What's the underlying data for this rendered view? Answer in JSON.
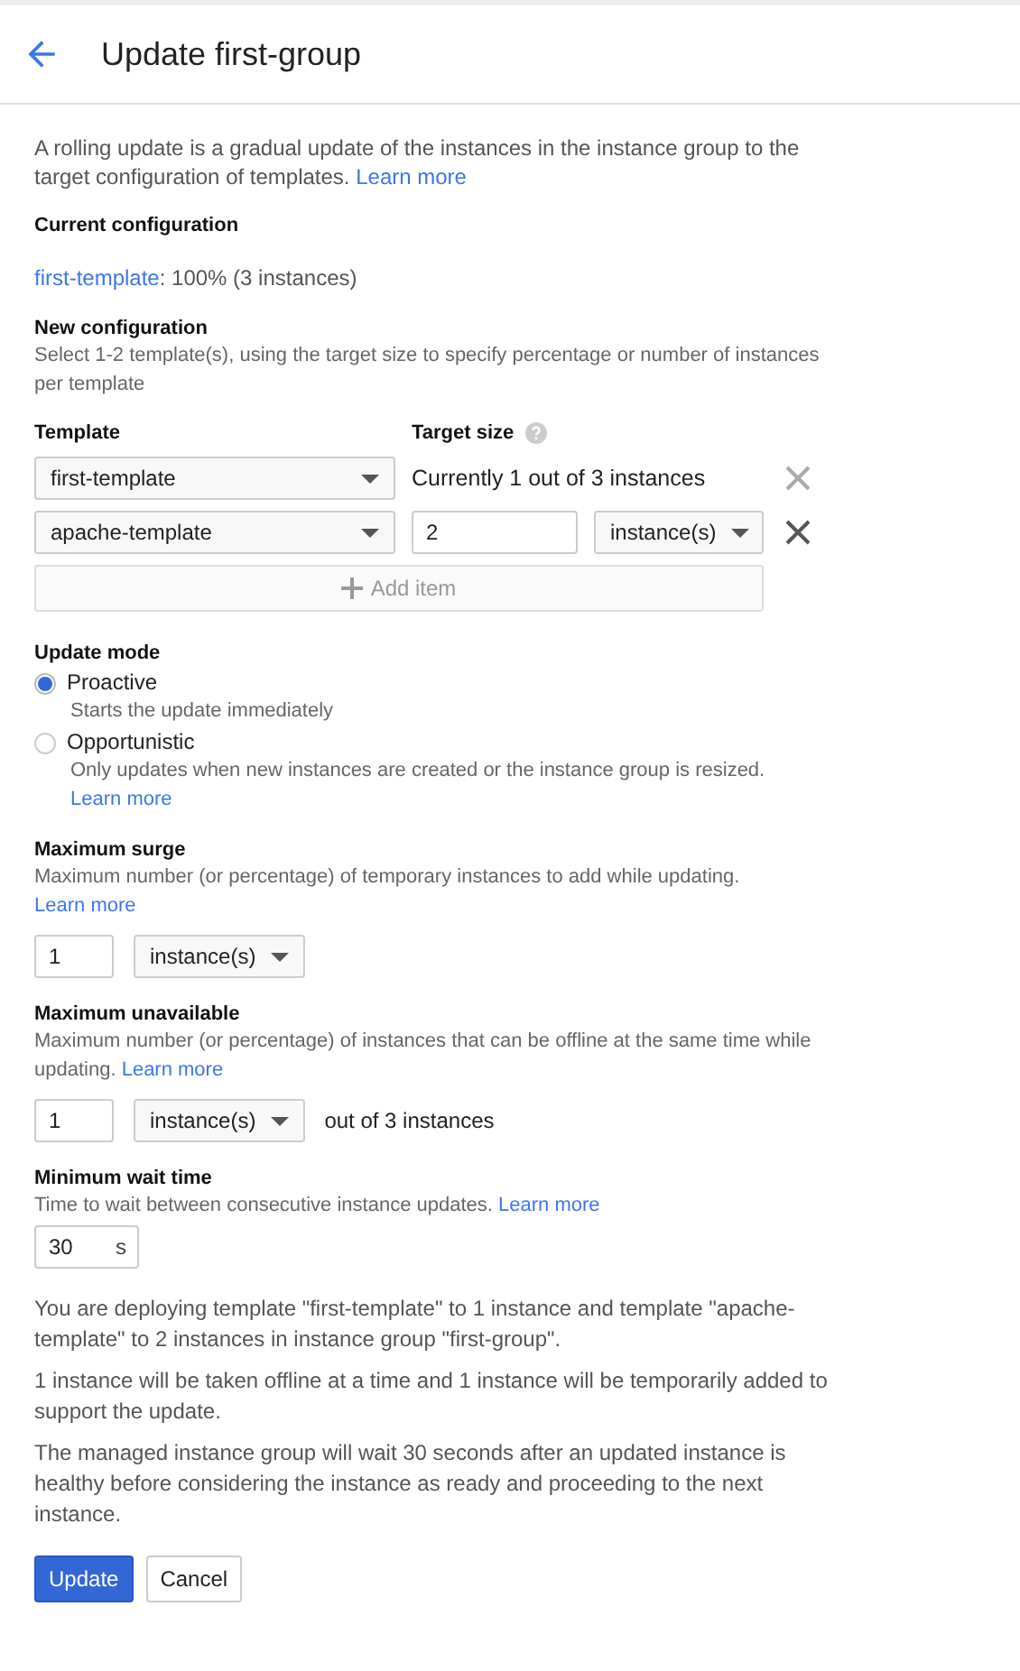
{
  "header": {
    "title": "Update first-group"
  },
  "intro": {
    "text": "A rolling update is a gradual update of the instances in the instance group to the target configuration of templates.",
    "link": "Learn more"
  },
  "current": {
    "heading": "Current configuration",
    "template": "first-template",
    "summary": ": 100% (3 instances)"
  },
  "new_config": {
    "heading": "New configuration",
    "description": "Select 1-2 template(s), using the target size to specify percentage or number of instances per template",
    "columns": [
      "Template",
      "Target size"
    ],
    "rows": [
      {
        "kind": "fixed",
        "template": "first-template",
        "target": "Currently 1 out of 3 instances",
        "remove_disabled": true
      },
      {
        "kind": "custom",
        "template": "apache-template",
        "value": "2",
        "unit": "instance(s)",
        "remove_disabled": false
      }
    ],
    "add_item": {
      "label": "Add item",
      "disabled": true
    }
  },
  "update_mode": {
    "heading": "Update mode",
    "options": [
      {
        "label": "Proactive",
        "description": "Starts the update immediately",
        "selected": true
      },
      {
        "label": "Opportunistic",
        "description": "Only updates when new instances are created or the instance group is resized.",
        "link": "Learn more",
        "selected": false
      }
    ]
  },
  "settings": [
    {
      "kind": "dropdown",
      "heading": "Maximum surge",
      "description": "Maximum number (or percentage) of temporary instances to add while updating.",
      "link": "Learn more",
      "value": "1",
      "unit": "instance(s)"
    },
    {
      "kind": "dropdown",
      "heading": "Maximum unavailable",
      "description": "Maximum number (or percentage) of instances that can be offline at the same time while updating.",
      "link": "Learn more",
      "value": "1",
      "unit": "instance(s)",
      "suffix": "out of 3 instances"
    },
    {
      "kind": "seconds",
      "heading": "Minimum wait time",
      "description": "Time to wait between consecutive instance updates.",
      "link": "Learn more",
      "value": "30",
      "unit": "s"
    }
  ],
  "summary": [
    "You are deploying template \"first-template\" to 1 instance and template \"apache-template\" to 2 instances in instance group \"first-group\".",
    "1 instance will be taken offline at a time and 1 instance will be temporarily added to support the update.",
    "The managed instance group will wait 30 seconds after an updated instance is healthy before considering the instance as ready and proceeding to the next instance."
  ],
  "buttons": [
    {
      "kind": "primary",
      "label": "Update"
    },
    {
      "kind": "secondary",
      "label": "Cancel"
    }
  ]
}
